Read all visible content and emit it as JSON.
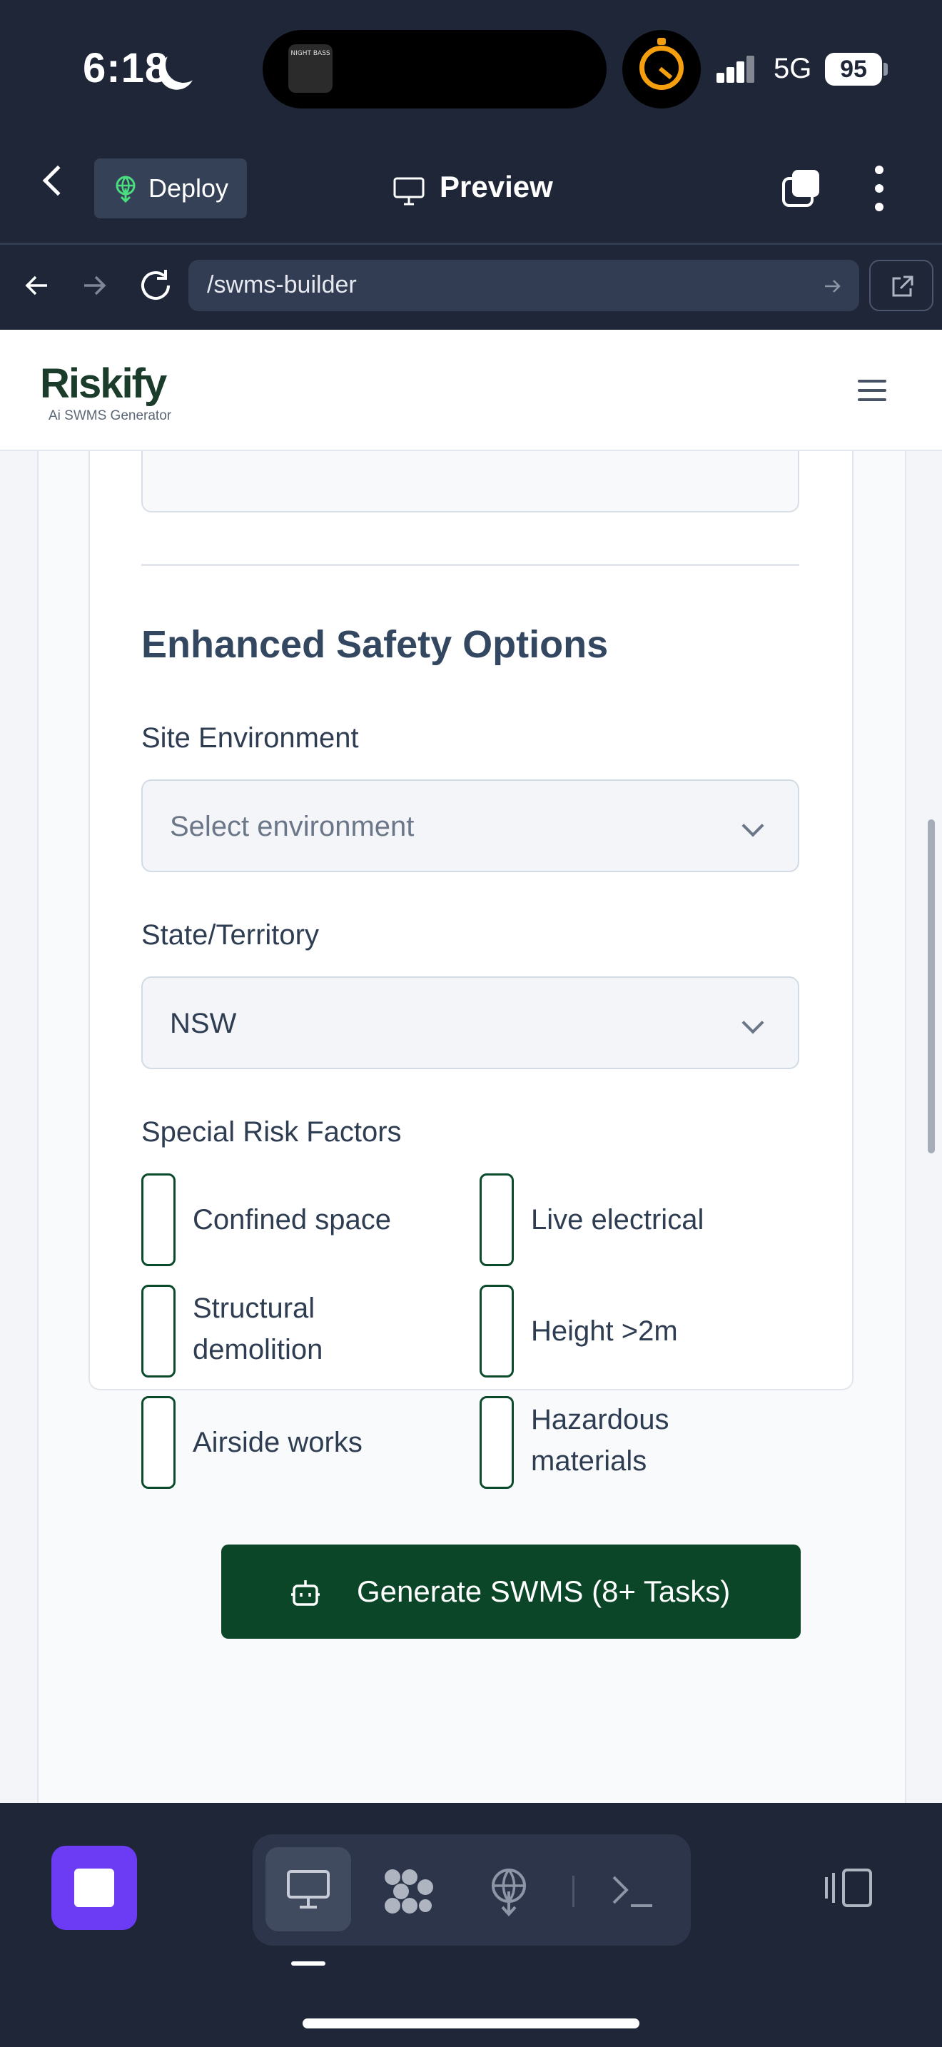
{
  "status_bar": {
    "time": "6:18",
    "network": "5G",
    "battery": "95",
    "now_playing_art_text": "NIGHT BASS"
  },
  "app_bar": {
    "deploy_label": "Deploy",
    "preview_label": "Preview"
  },
  "browser": {
    "url": "/swms-builder"
  },
  "site_header": {
    "logo_text": "Riskify",
    "logo_subtitle": "Ai SWMS Generator"
  },
  "form": {
    "section_title": "Enhanced Safety Options",
    "site_environment": {
      "label": "Site Environment",
      "placeholder": "Select environment"
    },
    "state_territory": {
      "label": "State/Territory",
      "value": "NSW"
    },
    "special_risk_factors": {
      "label": "Special Risk Factors",
      "options": [
        {
          "line1": "Confined space",
          "line2": "",
          "checked": false
        },
        {
          "line1": "Live electrical",
          "line2": "",
          "checked": false
        },
        {
          "line1": "Structural",
          "line2": "demolition",
          "checked": false
        },
        {
          "line1": "Height >2m",
          "line2": "",
          "checked": false
        },
        {
          "line1": "Airside works",
          "line2": "",
          "checked": false
        },
        {
          "line1": "Hazardous",
          "line2": "materials",
          "checked": false
        }
      ]
    },
    "generate_button_label": "Generate SWMS (8+ Tasks)"
  },
  "colors": {
    "primary_green": "#0b4628",
    "stop_button": "#6c3bf4",
    "app_dark": "#1e2638",
    "timer_orange": "#f59f0f"
  }
}
